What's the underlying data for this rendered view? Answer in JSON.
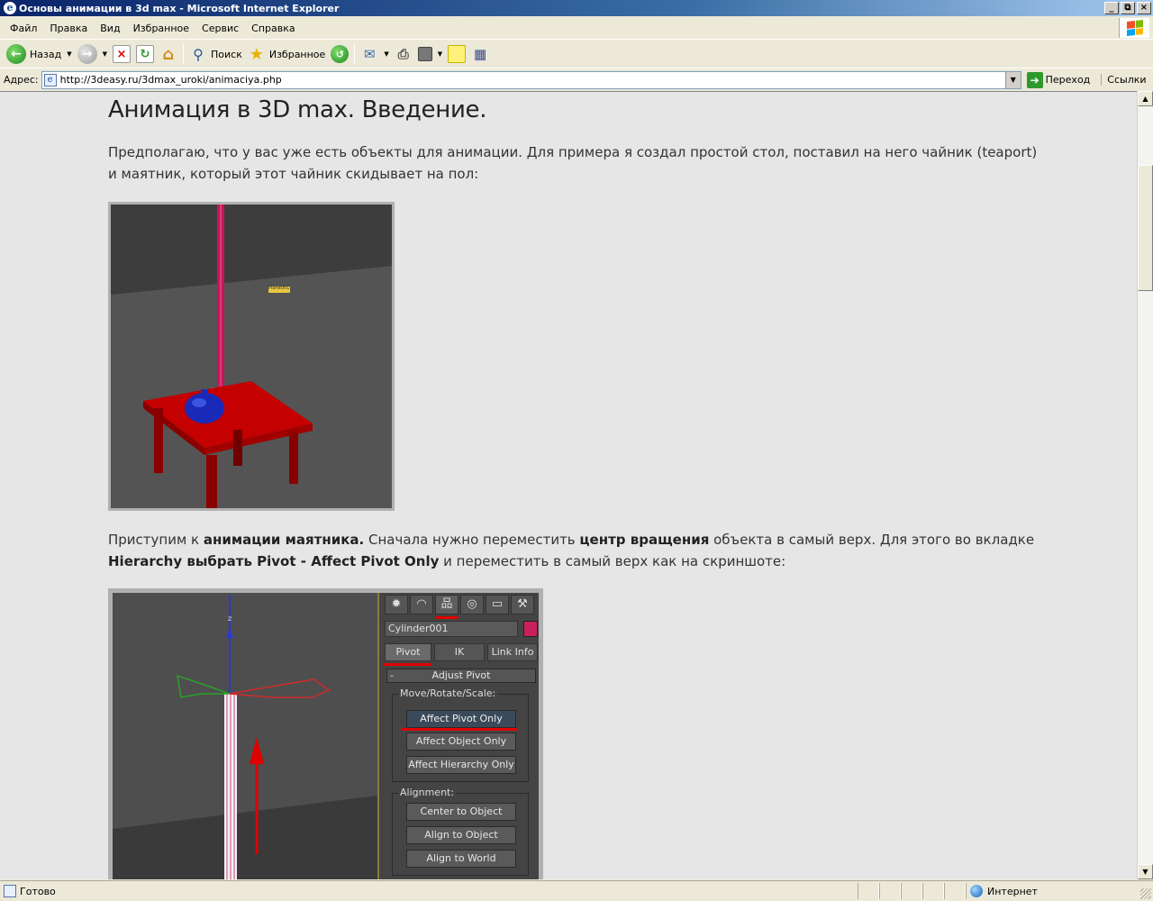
{
  "window": {
    "title": "Основы анимации в 3d max - Microsoft Internet Explorer",
    "buttons": [
      "_",
      "⧉",
      "×"
    ]
  },
  "menu": {
    "items": [
      "Файл",
      "Правка",
      "Вид",
      "Избранное",
      "Сервис",
      "Справка"
    ]
  },
  "toolbar": {
    "back_label": "Назад",
    "search_label": "Поиск",
    "favorites_label": "Избранное"
  },
  "address": {
    "label": "Адрес:",
    "url": "http://3deasy.ru/3dmax_uroki/animaciya.php",
    "go_label": "Переход",
    "links_label": "Ссылки"
  },
  "article": {
    "title": "Анимация в 3D max. Введение.",
    "p1": "Предполагаю, что у вас уже есть объекты для анимации. Для примера я создал простой стол, поставил на него чайник (teaport) и маятник, который этот чайник скидывает на пол:",
    "p2_a": "Приступим к ",
    "p2_b": "анимации маятника.",
    "p2_c": " Сначала нужно переместить ",
    "p2_d": "центр вращения",
    "p2_e": " объекта в самый верх. Для этого во вкладке ",
    "p2_f": "Hierarchy выбрать Pivot - Affect Pivot Only",
    "p2_g": " и переместить в самый верх как на скриншоте:",
    "img1_label": "Plane001"
  },
  "max_panel": {
    "object_name": "Cylinder001",
    "tabs": [
      "Pivot",
      "IK",
      "Link Info"
    ],
    "rollout": "Adjust Pivot",
    "rollout_minus": "-",
    "group1_label": "Move/Rotate/Scale:",
    "group1_buttons": [
      "Affect Pivot Only",
      "Affect Object Only",
      "Affect Hierarchy Only"
    ],
    "group2_label": "Alignment:",
    "group2_buttons": [
      "Center to Object",
      "Align to Object",
      "Align to World"
    ],
    "axis_label": "z"
  },
  "status": {
    "text": "Готово",
    "zone": "Интернет"
  },
  "colors": {
    "title_bar": "#0a246a",
    "page_bg": "#e6e6e6",
    "highlight_red": "#e00000"
  }
}
